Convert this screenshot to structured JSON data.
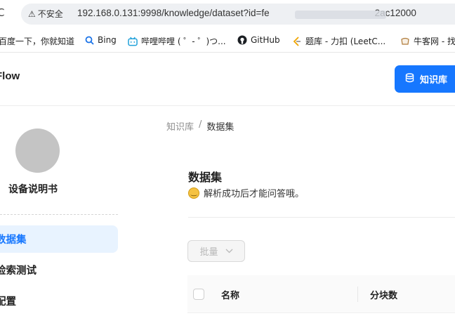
{
  "browser": {
    "security_label": "不安全",
    "url": "192.168.0.131:9998/knowledge/dataset?id=fe",
    "url_tail": "2ac12000"
  },
  "bookmarks": [
    {
      "label": "百度一下，你就知道",
      "icon": "none"
    },
    {
      "label": "Bing",
      "icon": "search-icon"
    },
    {
      "label": "哔哩哔哩 ( ゜- ゜)つ...",
      "icon": "bilibili-icon"
    },
    {
      "label": "GitHub",
      "icon": "github-icon"
    },
    {
      "label": "题库 - 力扣 (LeetC...",
      "icon": "leetcode-icon"
    },
    {
      "label": "牛客网 - 找",
      "icon": "nowcoder-icon"
    }
  ],
  "header": {
    "brand": "Flow",
    "kb_button": "知识库"
  },
  "sidebar": {
    "dataset_name": "设备说明书",
    "items": [
      {
        "label": "数据集",
        "active": true
      },
      {
        "label": "检索测试",
        "active": false
      },
      {
        "label": "配置",
        "active": false
      }
    ]
  },
  "main": {
    "breadcrumb": {
      "root": "知识库",
      "sep": "/",
      "current": "数据集"
    },
    "title": "数据集",
    "subtitle": "解析成功后才能问答哦。",
    "batch_button": "批量",
    "columns": [
      "名称",
      "分块数"
    ]
  },
  "colors": {
    "accent": "#1677ff",
    "active_bg": "#e8f3ff"
  }
}
